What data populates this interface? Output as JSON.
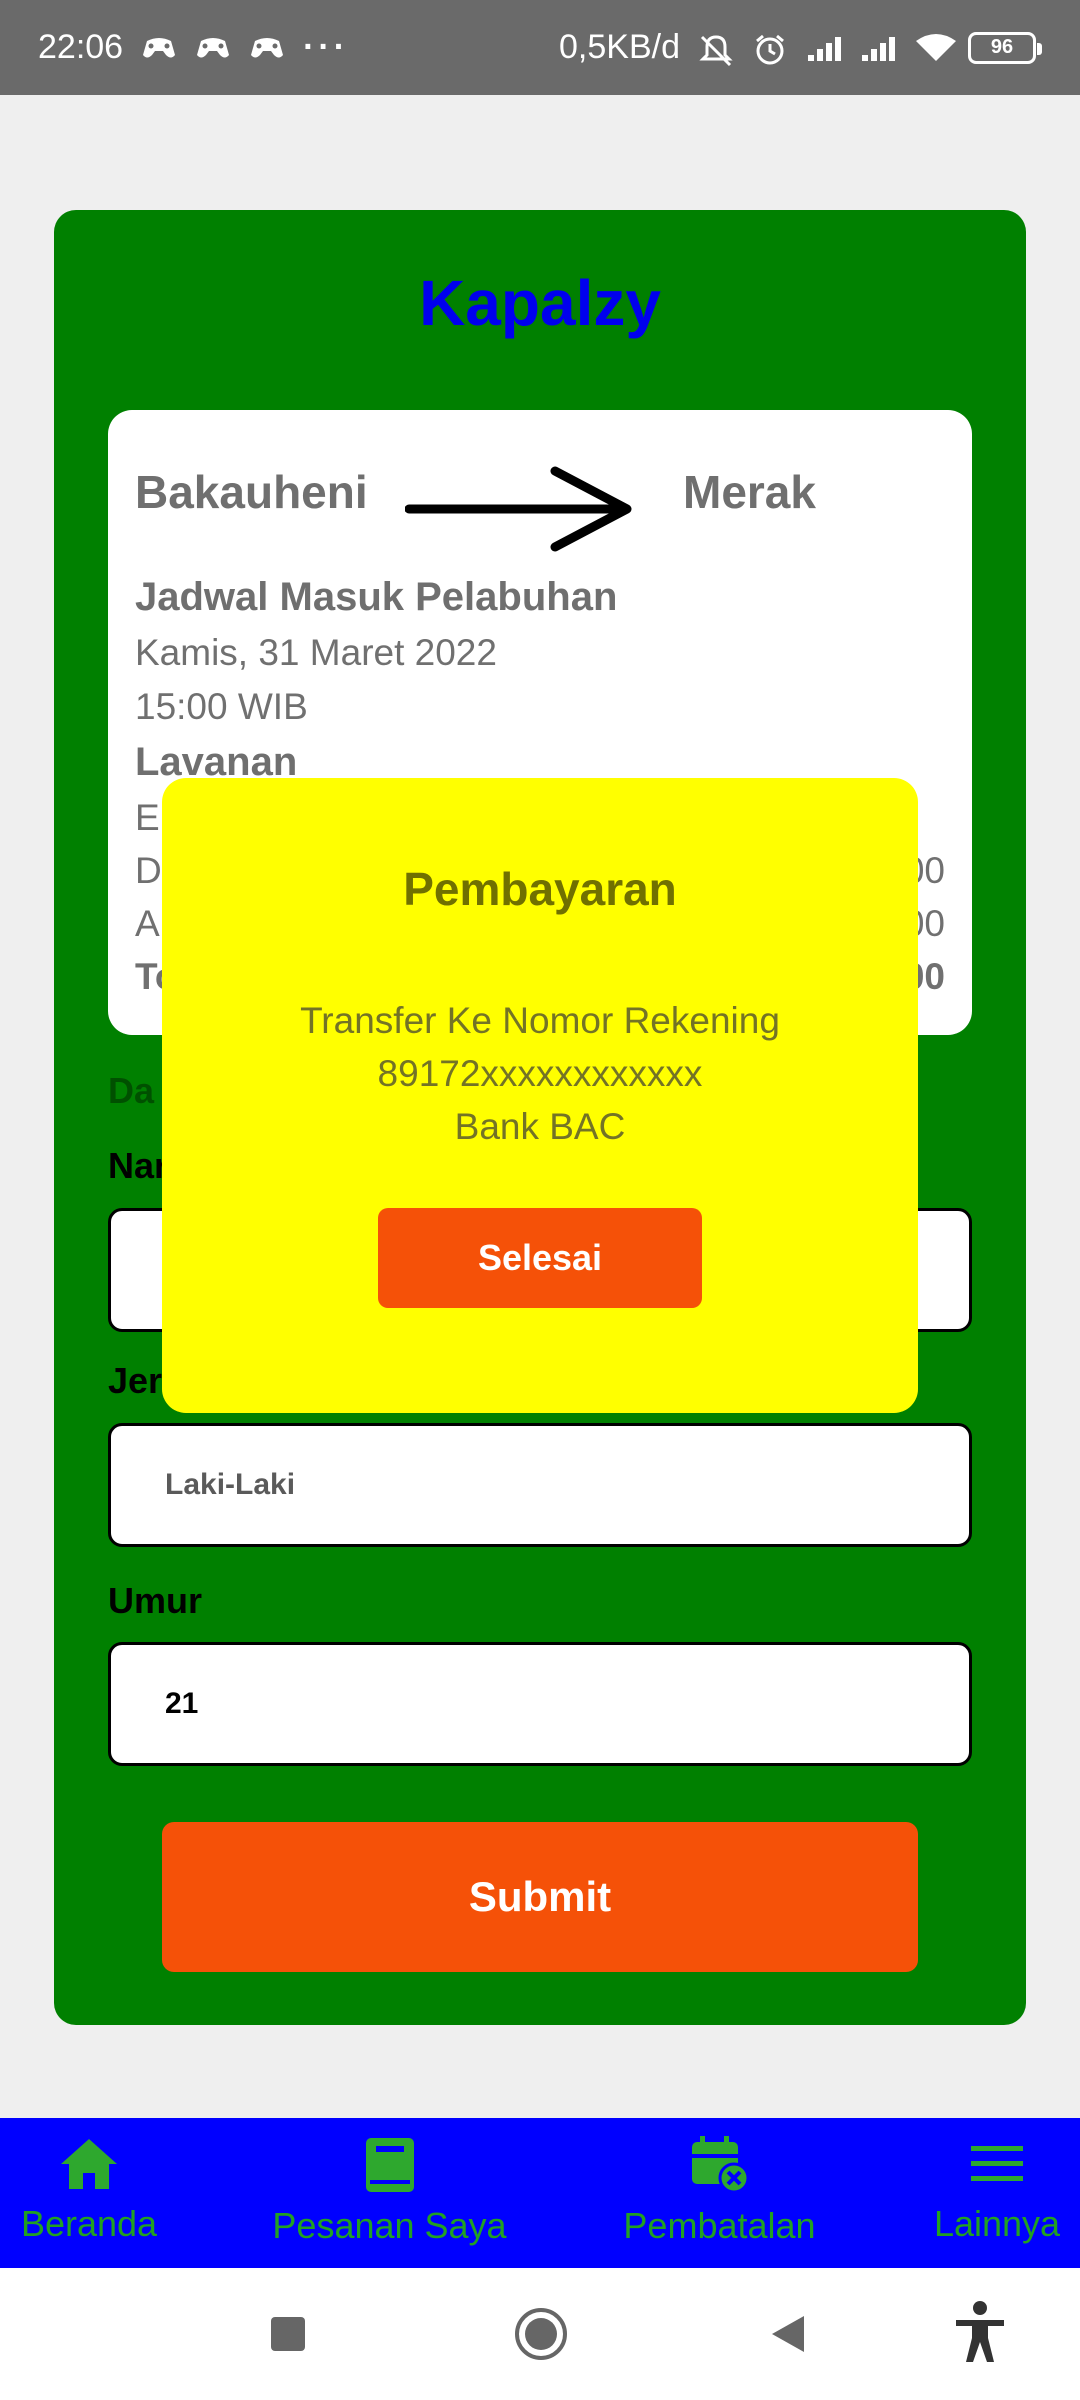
{
  "status_bar": {
    "time": "22:06",
    "more": "···",
    "net_speed": "0,5KB/d",
    "battery": "96"
  },
  "app": {
    "title": "Kapalzy"
  },
  "trip": {
    "origin": "Bakauheni",
    "destination": "Merak",
    "schedule_title": "Jadwal Masuk Pelabuhan",
    "date": "Kamis, 31 Maret 2022",
    "time": "15:00 WIB",
    "service_title": "Lavanan",
    "partial_line1": "El",
    "partial_line2": "D",
    "partial_line3": "A",
    "partial_line4": "To",
    "partial_amt2": "00",
    "partial_amt3": "00",
    "partial_amt4": "00"
  },
  "form": {
    "section_partial": "Da",
    "name_label_partial": "Nar",
    "gender_label_partial": "Jer",
    "gender_value": "Laki-Laki",
    "age_label": "Umur",
    "age_value": "21",
    "submit": "Submit"
  },
  "modal": {
    "title": "Pembayaran",
    "line1": "Transfer Ke Nomor Rekening",
    "line2": "89172xxxxxxxxxxxx",
    "line3": "Bank BAC",
    "done": "Selesai"
  },
  "bottom_nav": [
    {
      "label": "Beranda",
      "icon": "home-icon"
    },
    {
      "label": "Pesanan Saya",
      "icon": "book-icon"
    },
    {
      "label": "Pembatalan",
      "icon": "calendar-cancel-icon"
    },
    {
      "label": "Lainnya",
      "icon": "menu-icon"
    }
  ],
  "colors": {
    "card_green": "#008000",
    "brand_blue": "#0000ee",
    "modal_yellow": "#ffff00",
    "action_orange": "#f55108",
    "nav_blue": "#0000ff",
    "nav_green": "#22a022"
  }
}
